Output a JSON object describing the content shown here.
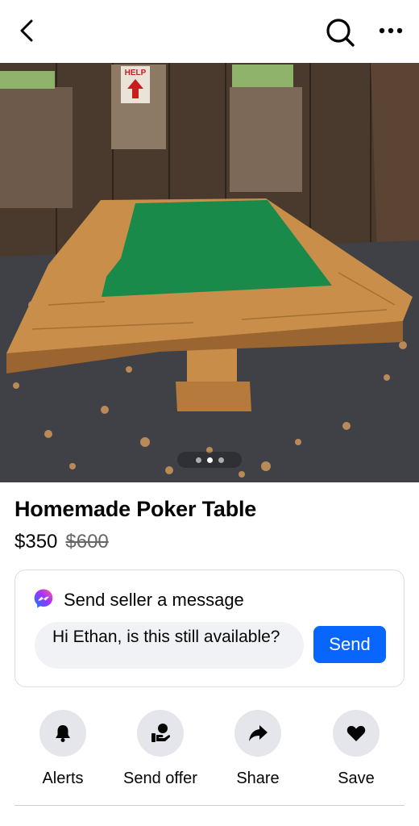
{
  "header": {
    "back_icon": "back-arrow-icon",
    "search_icon": "search-icon",
    "more_icon": "more-dots-icon"
  },
  "listing": {
    "title": "Homemade Poker Table",
    "price": "$350",
    "original_price": "$600",
    "photo_count": 3,
    "photo_current_index": 1,
    "photo_sign_text": "HELP"
  },
  "message": {
    "heading": "Send seller a message",
    "input_value": "Hi Ethan, is this still available?",
    "send_label": "Send",
    "messenger_icon": "messenger-icon",
    "accent_color": "#0866ff"
  },
  "actions": [
    {
      "label": "Alerts",
      "icon": "bell-icon"
    },
    {
      "label": "Send offer",
      "icon": "offer-hand-icon"
    },
    {
      "label": "Share",
      "icon": "share-arrow-icon"
    },
    {
      "label": "Save",
      "icon": "heart-icon"
    }
  ]
}
